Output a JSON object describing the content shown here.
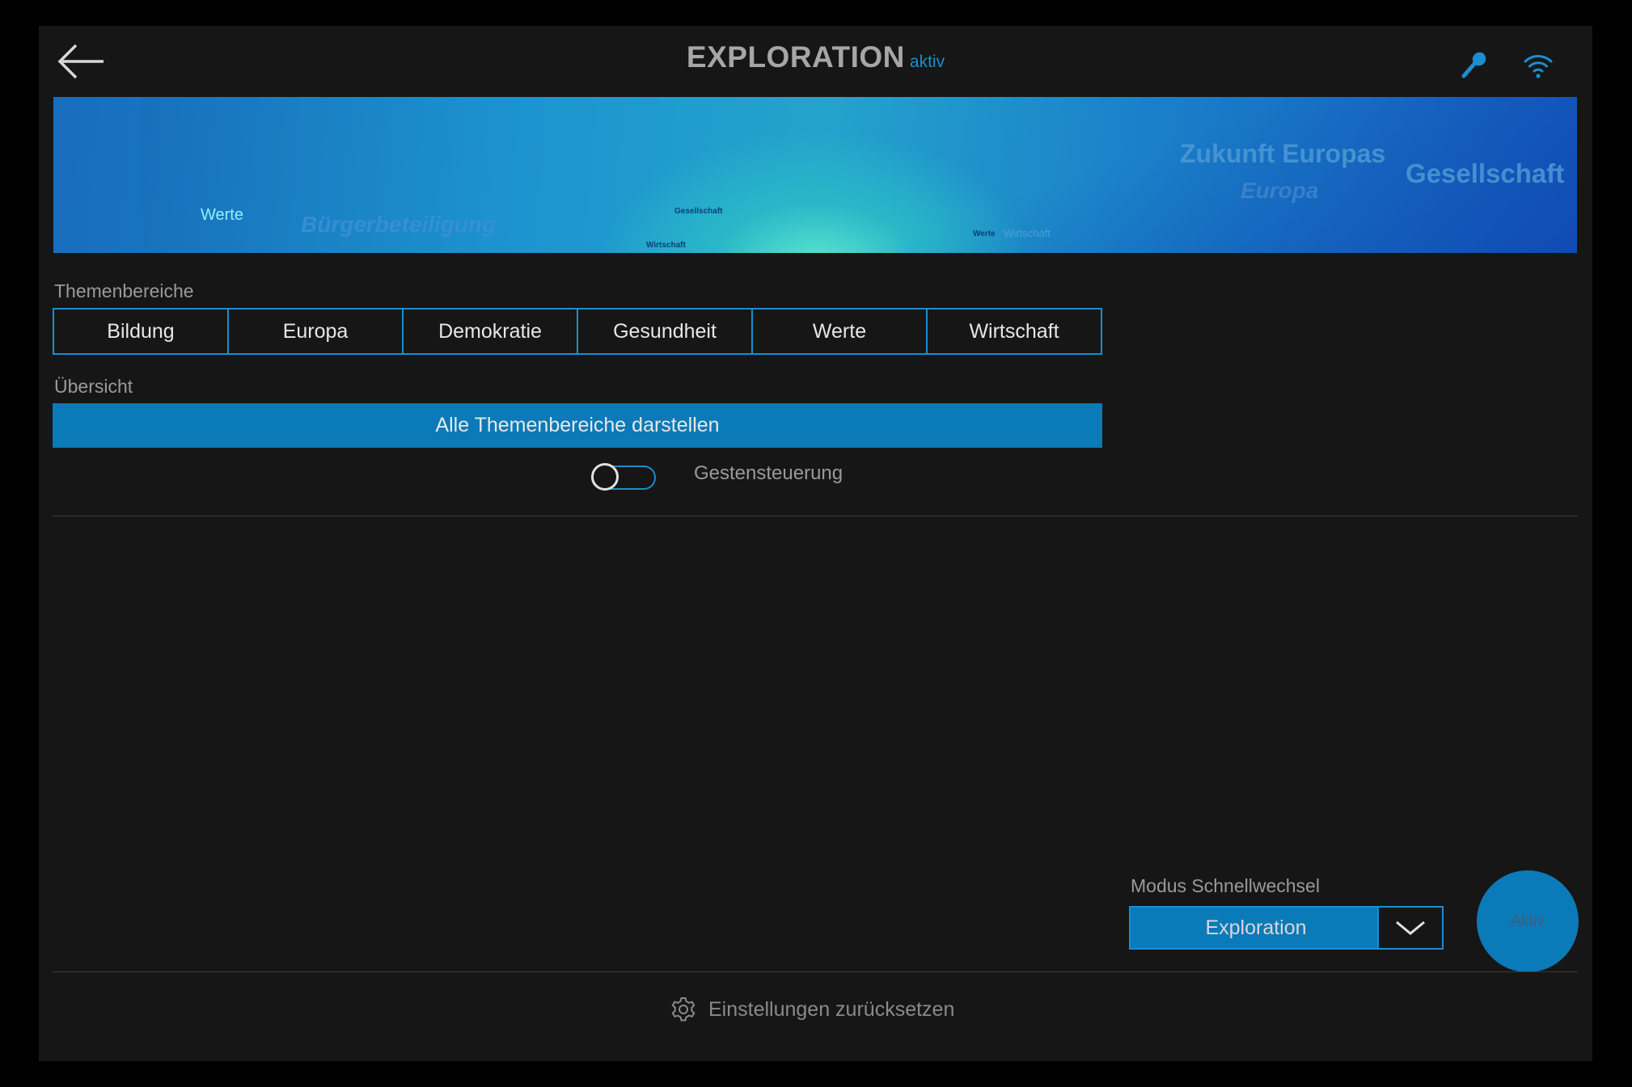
{
  "header": {
    "title": "EXPLORATION",
    "status": "aktiv",
    "back_icon": "arrow-left-icon",
    "mic_icon": "microphone-icon",
    "wifi_icon": "wifi-icon"
  },
  "banner": {
    "words": [
      "Werte",
      "Bürgerbeteiligung",
      "Gesellschaft",
      "Wirtschaft",
      "Zukunft Europas",
      "Europa",
      "Gesellschaft",
      "Werte",
      "Wirtschaft"
    ]
  },
  "topics": {
    "label": "Themenbereiche",
    "items": [
      "Bildung",
      "Europa",
      "Demokratie",
      "Gesundheit",
      "Werte",
      "Wirtschaft"
    ]
  },
  "overview": {
    "label": "Übersicht",
    "button": "Alle Themenbereiche darstellen"
  },
  "gesture": {
    "label": "Gestensteuerung",
    "enabled": false
  },
  "mode": {
    "label": "Modus Schnellwechsel",
    "selected": "Exploration",
    "active_button": "Aktiv"
  },
  "reset": {
    "label": "Einstellungen zurücksetzen",
    "icon": "gear-icon"
  },
  "colors": {
    "accent": "#1a8ed0",
    "button_fill": "#0b7ab8",
    "background": "#161616"
  }
}
